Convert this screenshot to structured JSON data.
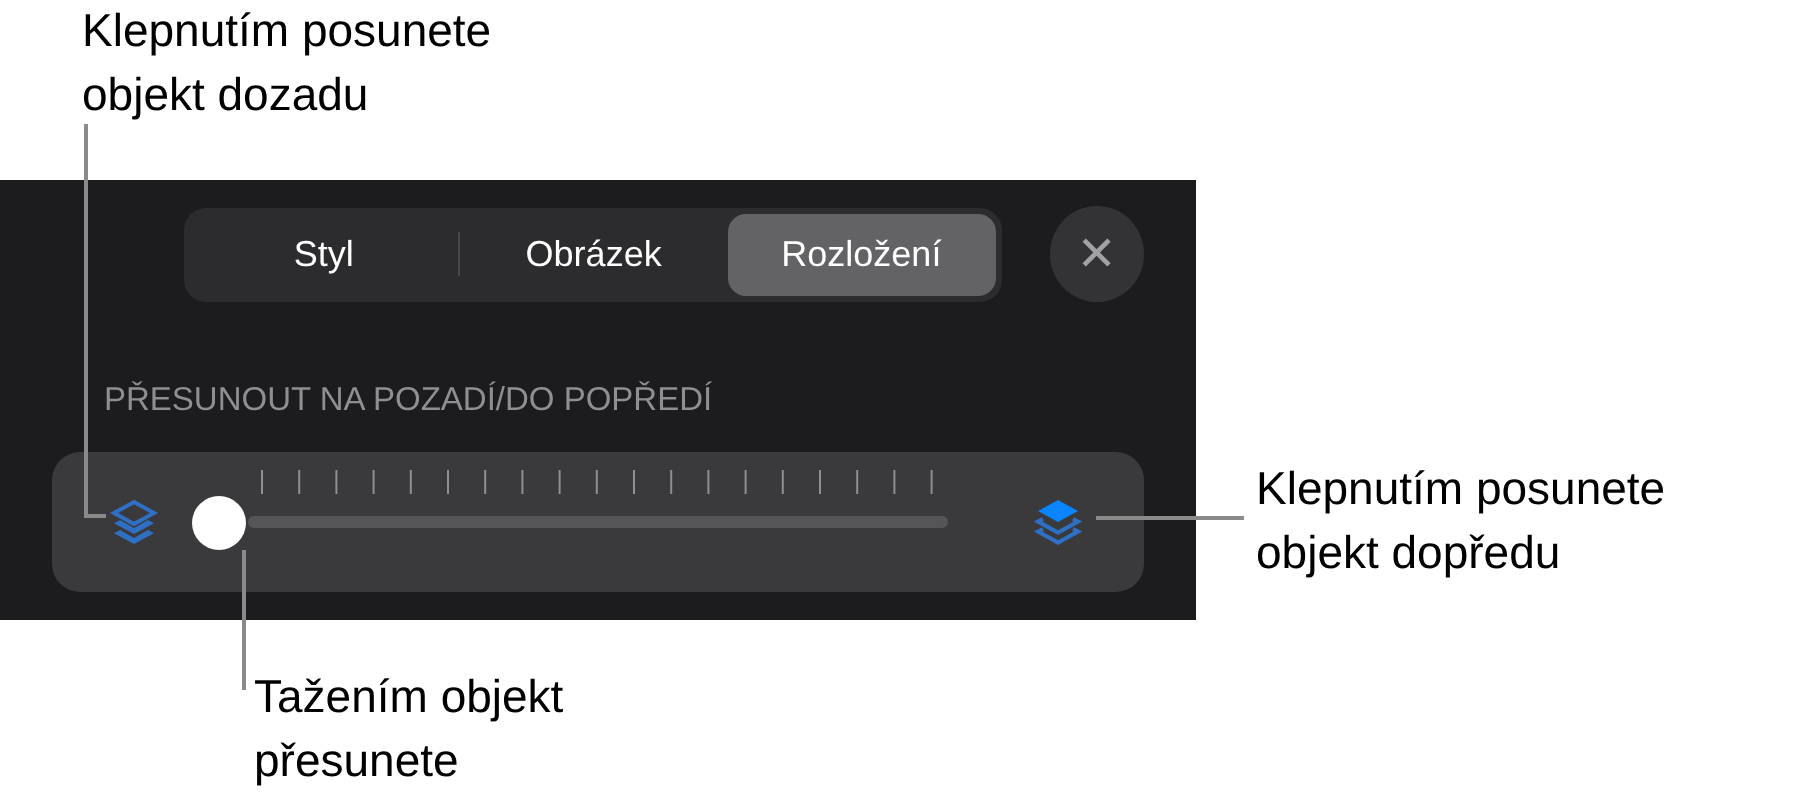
{
  "segments": [
    {
      "label": "Styl",
      "selected": false
    },
    {
      "label": "Obrázek",
      "selected": false
    },
    {
      "label": "Rozložení",
      "selected": true
    }
  ],
  "close_button": {
    "label": "✕"
  },
  "section_label": "PŘESUNOUT NA POZADÍ/DO POPŘEDÍ",
  "callouts": [
    {
      "kind": "top",
      "text": "Klepnutím posunete\nobjekt dozadu"
    },
    {
      "kind": "right",
      "text": "Klepnutím posunete\nobjekt dopředu"
    },
    {
      "kind": "bottom",
      "text": "Tažením objekt\npřesunete"
    }
  ]
}
